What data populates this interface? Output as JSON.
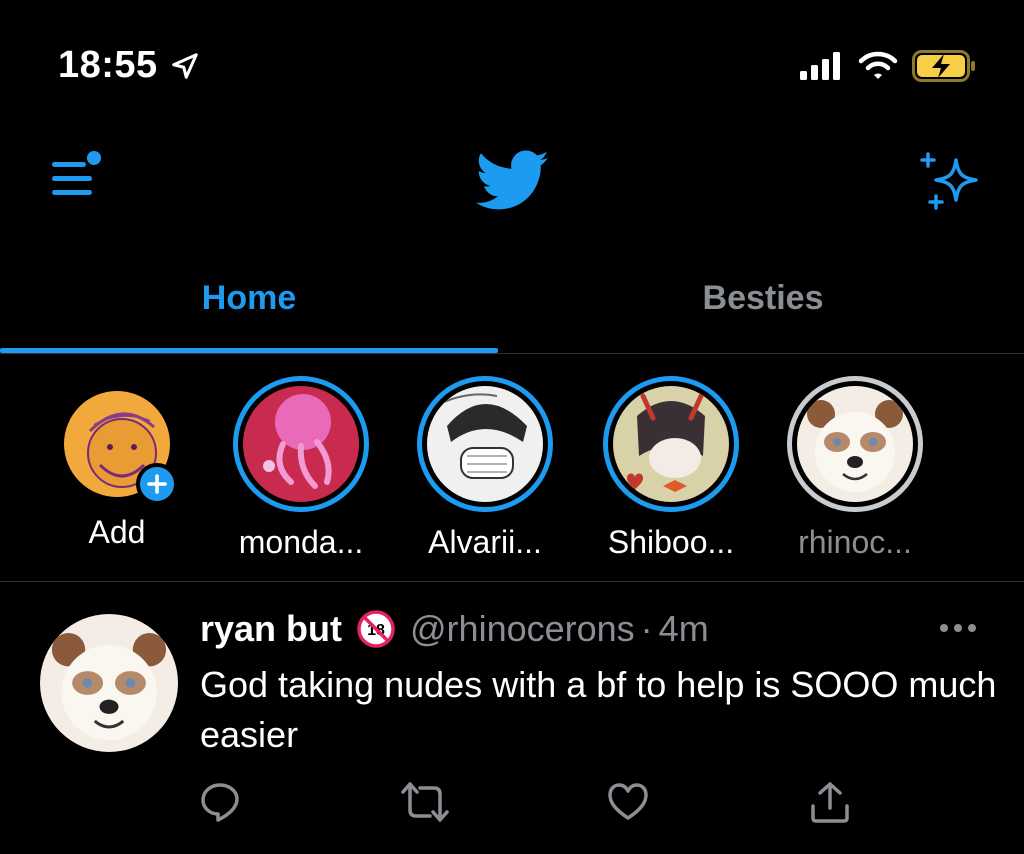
{
  "status_bar": {
    "time": "18:55"
  },
  "tabs": [
    {
      "label": "Home"
    },
    {
      "label": "Besties"
    }
  ],
  "fleets": [
    {
      "name": "Add"
    },
    {
      "name": "monda..."
    },
    {
      "name": "Alvarii..."
    },
    {
      "name": "Shiboo..."
    },
    {
      "name": "rhinoc..."
    }
  ],
  "tweet": {
    "display_name": "ryan but",
    "badge": "18",
    "handle": "@rhinocerons",
    "separator": "·",
    "time": "4m",
    "text": "God taking nudes with a bf to help is SOOO much easier"
  },
  "colors": {
    "accent": "#1d9bf0",
    "muted": "#8b8f94",
    "background": "#000000",
    "battery": "#f7ce46"
  },
  "icons": [
    "location-arrow-icon",
    "signal-icon",
    "wifi-icon",
    "battery-charging-icon",
    "menu-icon",
    "twitter-bird-icon",
    "sparkle-icon",
    "plus-icon",
    "more-icon",
    "reply-icon",
    "retweet-icon",
    "like-icon",
    "share-icon"
  ]
}
